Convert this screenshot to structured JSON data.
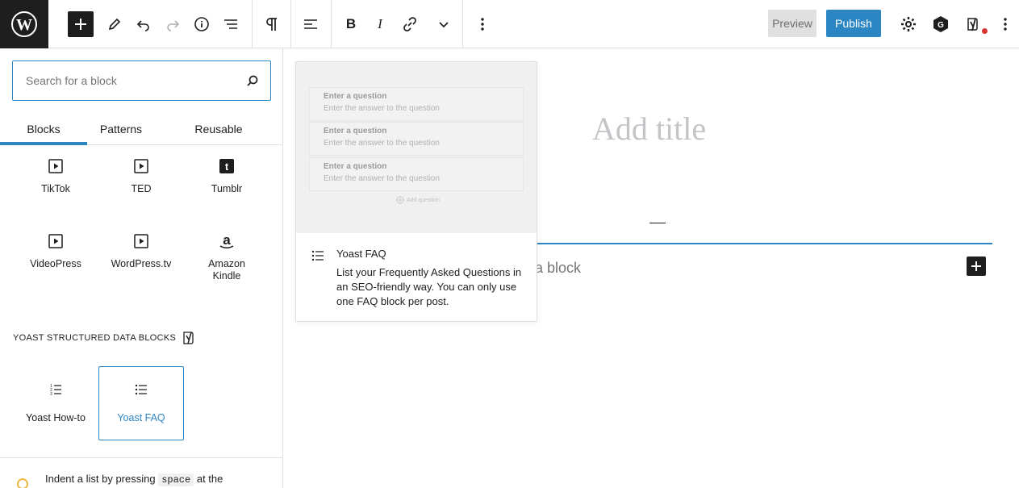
{
  "toolbar": {
    "preview_label": "Preview",
    "publish_label": "Publish",
    "publish_color": "#2d86c4",
    "icons": [
      "wordpress-logo",
      "plus",
      "pencil",
      "undo",
      "redo",
      "info",
      "list-view",
      "paragraph",
      "align-left",
      "bold",
      "italic",
      "link",
      "chevron-down",
      "more-vertical",
      "gear",
      "avatar-g",
      "yoast-logo",
      "more-vertical"
    ]
  },
  "sidebar": {
    "search": {
      "placeholder": "Search for a block",
      "value": ""
    },
    "tabs": [
      {
        "label": "Blocks",
        "active": true
      },
      {
        "label": "Patterns",
        "active": false
      },
      {
        "label": "Reusable",
        "active": false
      }
    ],
    "embed_blocks": [
      {
        "label": "TikTok",
        "icon": "embed-video-icon"
      },
      {
        "label": "TED",
        "icon": "embed-video-icon"
      },
      {
        "label": "Tumblr",
        "icon": "tumblr-icon"
      },
      {
        "label": "VideoPress",
        "icon": "embed-video-icon"
      },
      {
        "label": "WordPress.tv",
        "icon": "embed-video-icon"
      },
      {
        "label": "Amazon Kindle",
        "icon": "amazon-icon"
      }
    ],
    "yoast_section_title": "YOAST STRUCTURED DATA BLOCKS",
    "yoast_blocks": [
      {
        "label": "Yoast How-to",
        "selected": false
      },
      {
        "label": "Yoast FAQ",
        "selected": true
      }
    ],
    "tip": {
      "text_before": "Indent a list by pressing",
      "kbd": "space",
      "text_after": "at the"
    }
  },
  "editor": {
    "title_placeholder": "Add title",
    "paragraph_placeholder": "a block"
  },
  "preview": {
    "questions": [
      {
        "q": "Enter a question",
        "a": "Enter the answer to the question"
      },
      {
        "q": "Enter a question",
        "a": "Enter the answer to the question"
      },
      {
        "q": "Enter a question",
        "a": "Enter the answer to the question"
      }
    ],
    "add_question": "Add question",
    "title": "Yoast FAQ",
    "description": "List your Frequently Asked Questions in an SEO-friendly way. You can only use one FAQ block per post."
  }
}
